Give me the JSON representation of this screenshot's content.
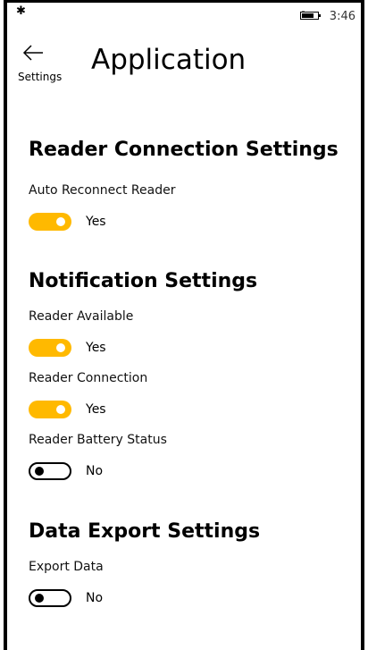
{
  "status_bar": {
    "bluetooth_icon": "bluetooth-icon",
    "battery_icon": "battery-icon",
    "time": "3:46"
  },
  "header": {
    "back_icon": "arrow-left-icon",
    "back_label": "Settings",
    "title": "Application"
  },
  "colors": {
    "accent": "#ffb900"
  },
  "sections": {
    "reader_connection": {
      "title": "Reader Connection Settings",
      "auto_reconnect": {
        "label": "Auto Reconnect Reader",
        "state": "Yes",
        "on": true
      }
    },
    "notification": {
      "title": "Notification Settings",
      "reader_available": {
        "label": "Reader Available",
        "state": "Yes",
        "on": true
      },
      "reader_connection": {
        "label": "Reader Connection",
        "state": "Yes",
        "on": true
      },
      "reader_battery": {
        "label": "Reader Battery Status",
        "state": "No",
        "on": false
      }
    },
    "data_export": {
      "title": "Data Export Settings",
      "export_data": {
        "label": "Export Data",
        "state": "No",
        "on": false
      }
    }
  }
}
